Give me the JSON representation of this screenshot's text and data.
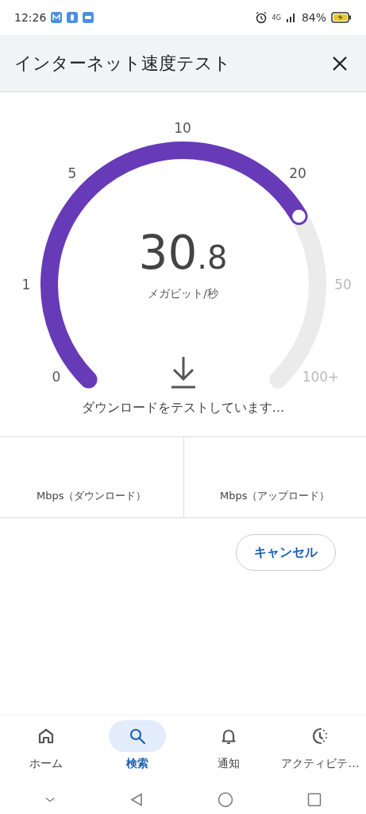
{
  "status_bar": {
    "time": "12:26",
    "network": "4G",
    "battery": "84%"
  },
  "header": {
    "title": "インターネット速度テスト"
  },
  "gauge": {
    "reading_whole": "30",
    "reading_fraction": ".8",
    "unit": "メガビット/秒",
    "status": "ダウンロードをテストしています...",
    "scale_labels": [
      {
        "text": "0",
        "reached": true
      },
      {
        "text": "1",
        "reached": true
      },
      {
        "text": "5",
        "reached": true
      },
      {
        "text": "10",
        "reached": true
      },
      {
        "text": "20",
        "reached": true
      },
      {
        "text": "50",
        "reached": false
      },
      {
        "text": "100+",
        "reached": false
      }
    ]
  },
  "results": [
    {
      "label": "Mbps（ダウンロード）"
    },
    {
      "label": "Mbps（アップロード）"
    }
  ],
  "cancel_button": "キャンセル",
  "bottom_nav": [
    {
      "kind": "home",
      "label": "ホーム",
      "selected": false
    },
    {
      "kind": "search",
      "label": "検索",
      "selected": true
    },
    {
      "kind": "bell",
      "label": "通知",
      "selected": false
    },
    {
      "kind": "activity",
      "label": "アクティビテ…",
      "selected": false
    }
  ]
}
